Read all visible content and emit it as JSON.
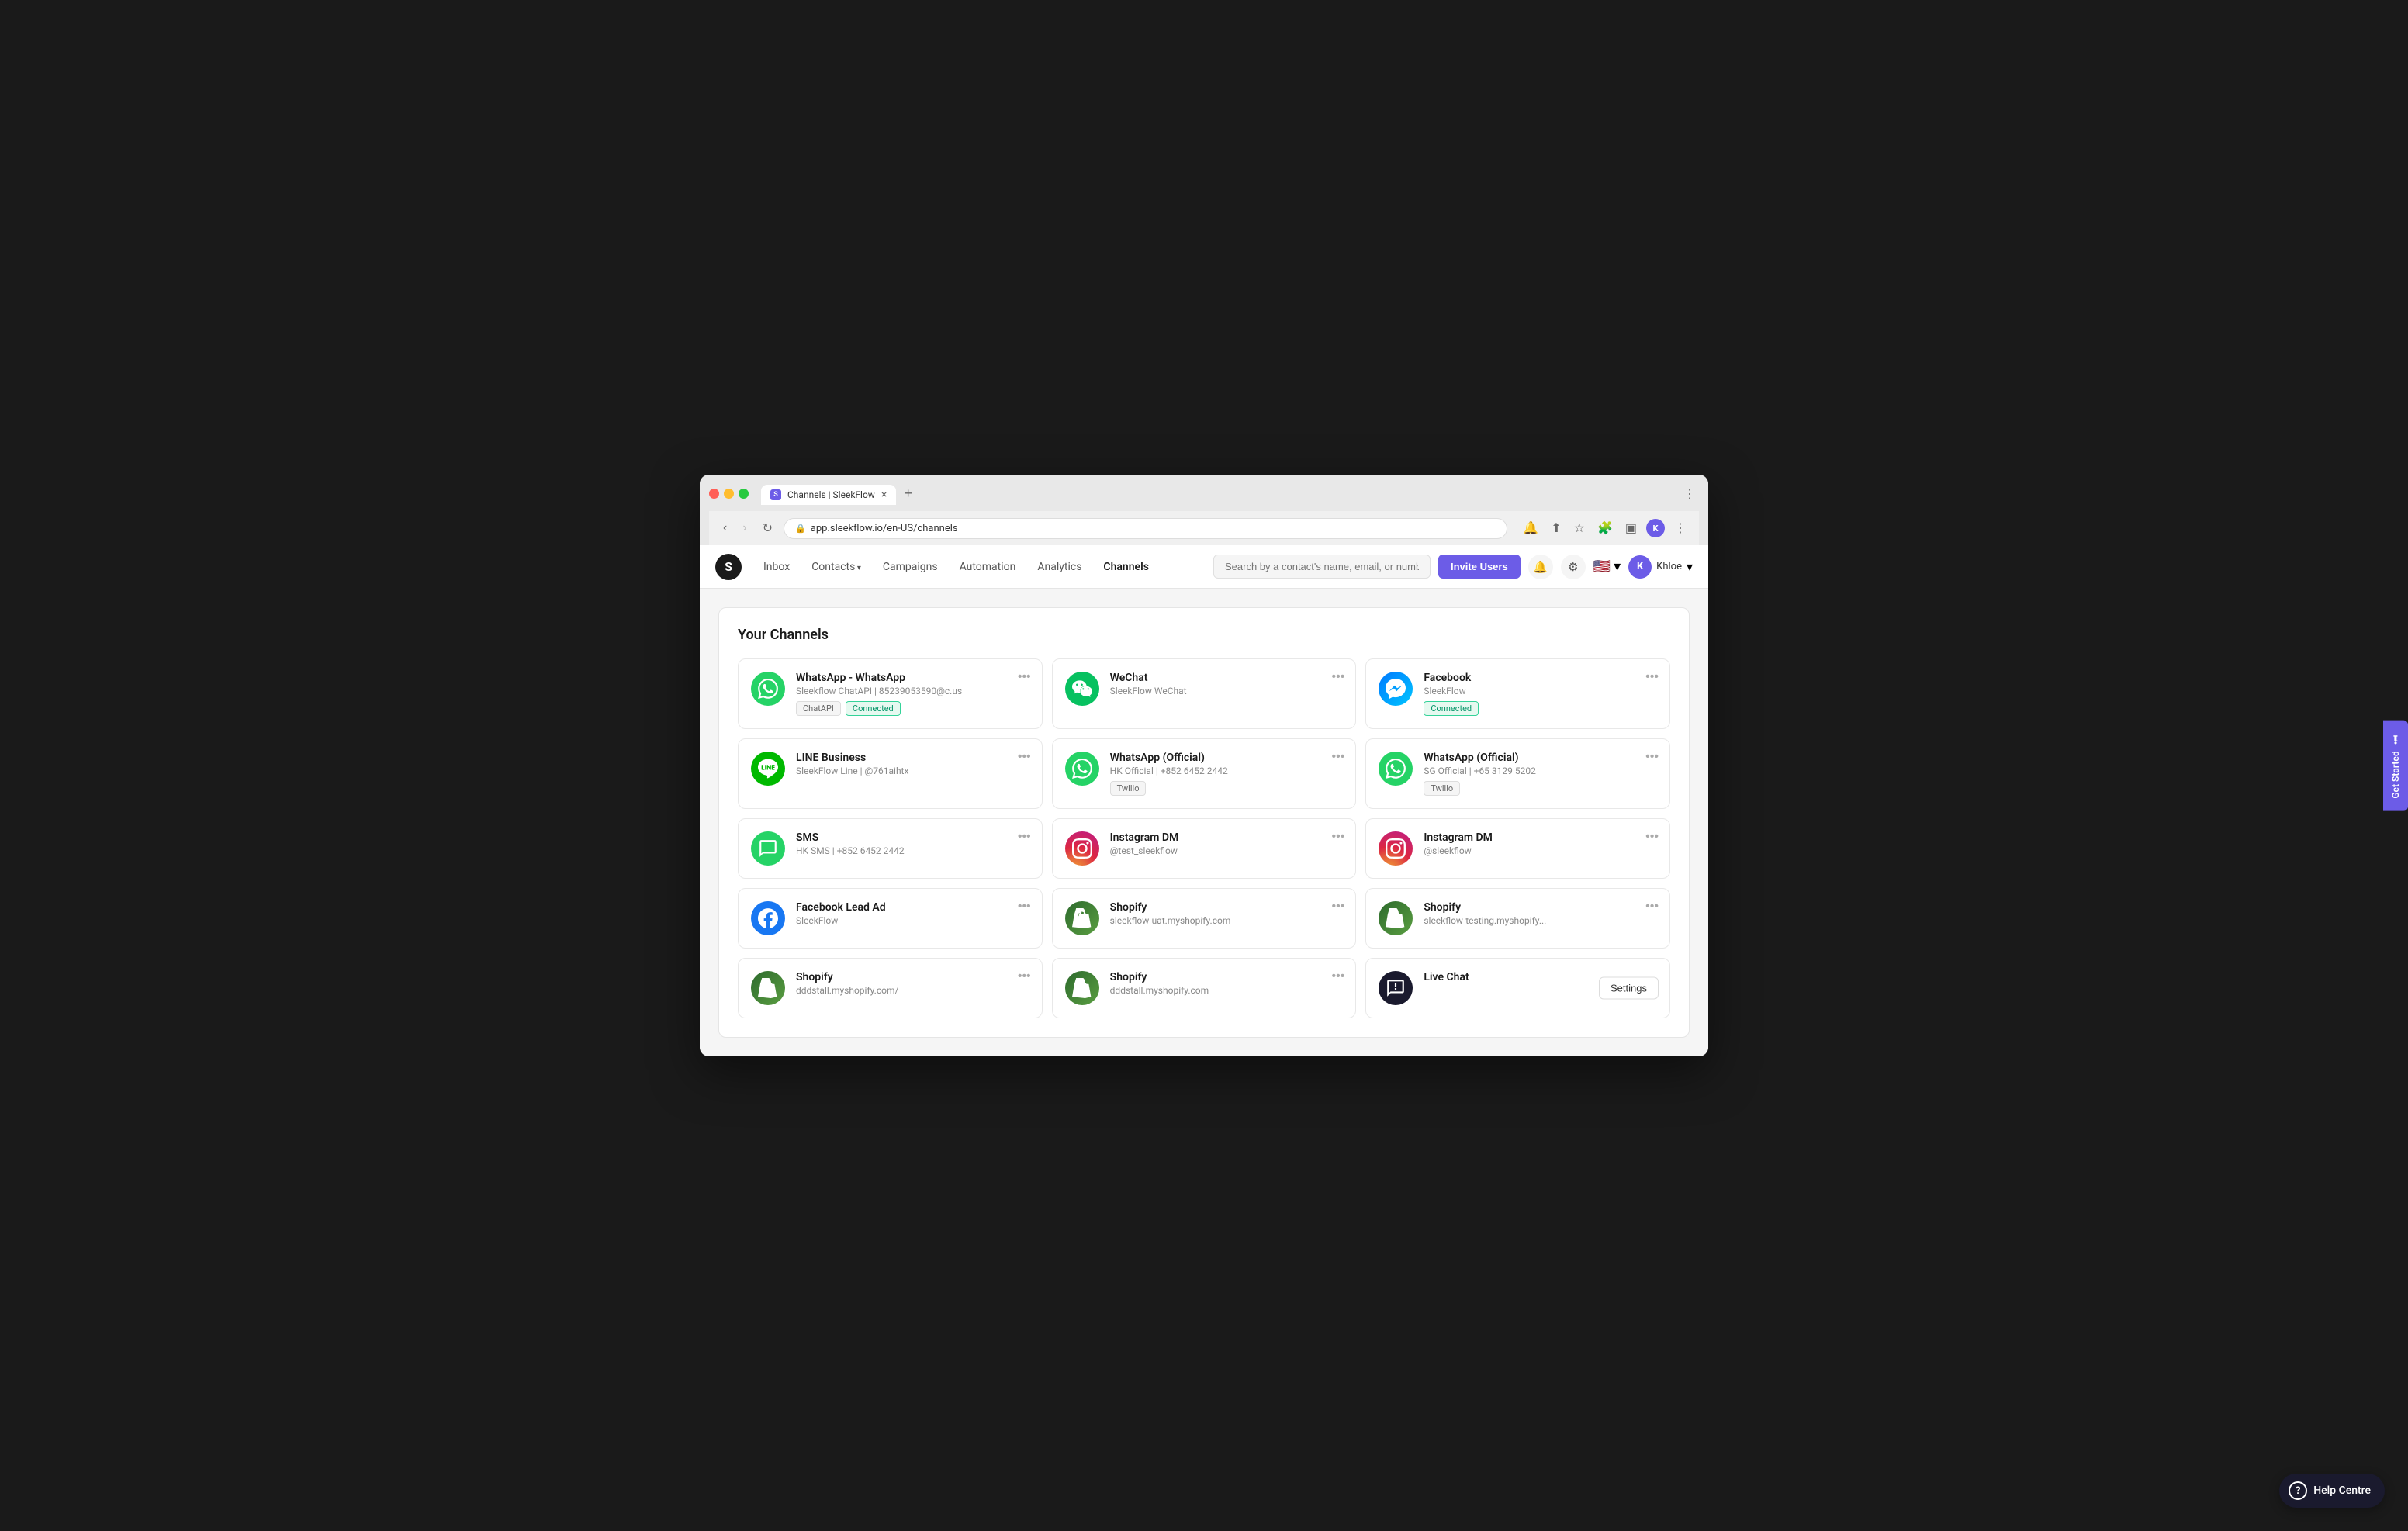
{
  "browser": {
    "tab_favicon": "S",
    "tab_title": "Channels | SleekFlow",
    "tab_close": "×",
    "tab_new": "+",
    "address": "app.sleekflow.io/en-US/channels",
    "nav_more": "⋮"
  },
  "nav": {
    "logo": "S",
    "links": [
      {
        "label": "Inbox",
        "active": false,
        "has_arrow": false
      },
      {
        "label": "Contacts",
        "active": false,
        "has_arrow": true
      },
      {
        "label": "Campaigns",
        "active": false,
        "has_arrow": false
      },
      {
        "label": "Automation",
        "active": false,
        "has_arrow": false
      },
      {
        "label": "Analytics",
        "active": false,
        "has_arrow": false
      },
      {
        "label": "Channels",
        "active": true,
        "has_arrow": false
      }
    ],
    "search_placeholder": "Search by a contact's name, email, or number",
    "invite_btn": "Invite Users",
    "flag": "🇺🇸",
    "user_initial": "K",
    "user_name": "Khloe"
  },
  "page": {
    "title": "Your Channels"
  },
  "channels": [
    {
      "name": "WhatsApp - WhatsApp",
      "sub": "Sleekflow ChatAPI | 85239053590@c.us",
      "icon_type": "whatsapp",
      "icon_char": "●",
      "badges": [
        {
          "label": "ChatAPI",
          "type": "default"
        },
        {
          "label": "Connected",
          "type": "connected"
        }
      ],
      "has_menu": true,
      "has_settings": false
    },
    {
      "name": "WeChat",
      "sub": "SleekFlow WeChat",
      "icon_type": "wechat",
      "icon_char": "●",
      "badges": [],
      "has_menu": true,
      "has_settings": false
    },
    {
      "name": "Facebook",
      "sub": "SleekFlow",
      "icon_type": "facebook-messenger",
      "icon_char": "●",
      "badges": [
        {
          "label": "Connected",
          "type": "connected"
        }
      ],
      "has_menu": true,
      "has_settings": false
    },
    {
      "name": "LINE Business",
      "sub": "SleekFlow Line | @761aihtx",
      "icon_type": "line",
      "icon_char": "●",
      "badges": [],
      "has_menu": true,
      "has_settings": false
    },
    {
      "name": "WhatsApp (Official)",
      "sub": "HK Official | +852 6452 2442",
      "icon_type": "whatsapp",
      "icon_char": "●",
      "badges": [
        {
          "label": "Twilio",
          "type": "default"
        }
      ],
      "has_menu": true,
      "has_settings": false
    },
    {
      "name": "WhatsApp (Official)",
      "sub": "SG Official | +65 3129 5202",
      "icon_type": "whatsapp",
      "icon_char": "●",
      "badges": [
        {
          "label": "Twilio",
          "type": "default"
        }
      ],
      "has_menu": true,
      "has_settings": false
    },
    {
      "name": "SMS",
      "sub": "HK SMS | +852 6452 2442",
      "icon_type": "sms",
      "icon_char": "●",
      "badges": [],
      "has_menu": true,
      "has_settings": false
    },
    {
      "name": "Instagram DM",
      "sub": "@test_sleekflow",
      "icon_type": "instagram",
      "icon_char": "📷",
      "badges": [],
      "has_menu": true,
      "has_settings": false
    },
    {
      "name": "Instagram DM",
      "sub": "@sleekflow",
      "icon_type": "instagram",
      "icon_char": "📷",
      "badges": [],
      "has_menu": true,
      "has_settings": false
    },
    {
      "name": "Facebook Lead Ad",
      "sub": "SleekFlow",
      "icon_type": "facebook-lead",
      "icon_char": "f",
      "badges": [],
      "has_menu": true,
      "has_settings": false
    },
    {
      "name": "Shopify",
      "sub": "sleekflow-uat.myshopify.com",
      "icon_type": "shopify",
      "icon_char": "S",
      "badges": [],
      "has_menu": true,
      "has_settings": false
    },
    {
      "name": "Shopify",
      "sub": "sleekflow-testing.myshopify...",
      "icon_type": "shopify",
      "icon_char": "S",
      "badges": [],
      "has_menu": true,
      "has_settings": false
    },
    {
      "name": "Shopify",
      "sub": "dddstall.myshopify.com/",
      "icon_type": "shopify",
      "icon_char": "S",
      "badges": [],
      "has_menu": true,
      "has_settings": false
    },
    {
      "name": "Shopify",
      "sub": "dddstall.myshopify.com",
      "icon_type": "shopify",
      "icon_char": "S",
      "badges": [],
      "has_menu": true,
      "has_settings": false
    },
    {
      "name": "Live Chat",
      "sub": "",
      "icon_type": "livechat",
      "icon_char": "💬",
      "badges": [],
      "has_menu": false,
      "has_settings": true,
      "settings_label": "Settings"
    }
  ],
  "get_started": {
    "label": "Get Started",
    "icon": "ℹ"
  },
  "help_centre": {
    "label": "Help Centre",
    "icon": "?"
  }
}
